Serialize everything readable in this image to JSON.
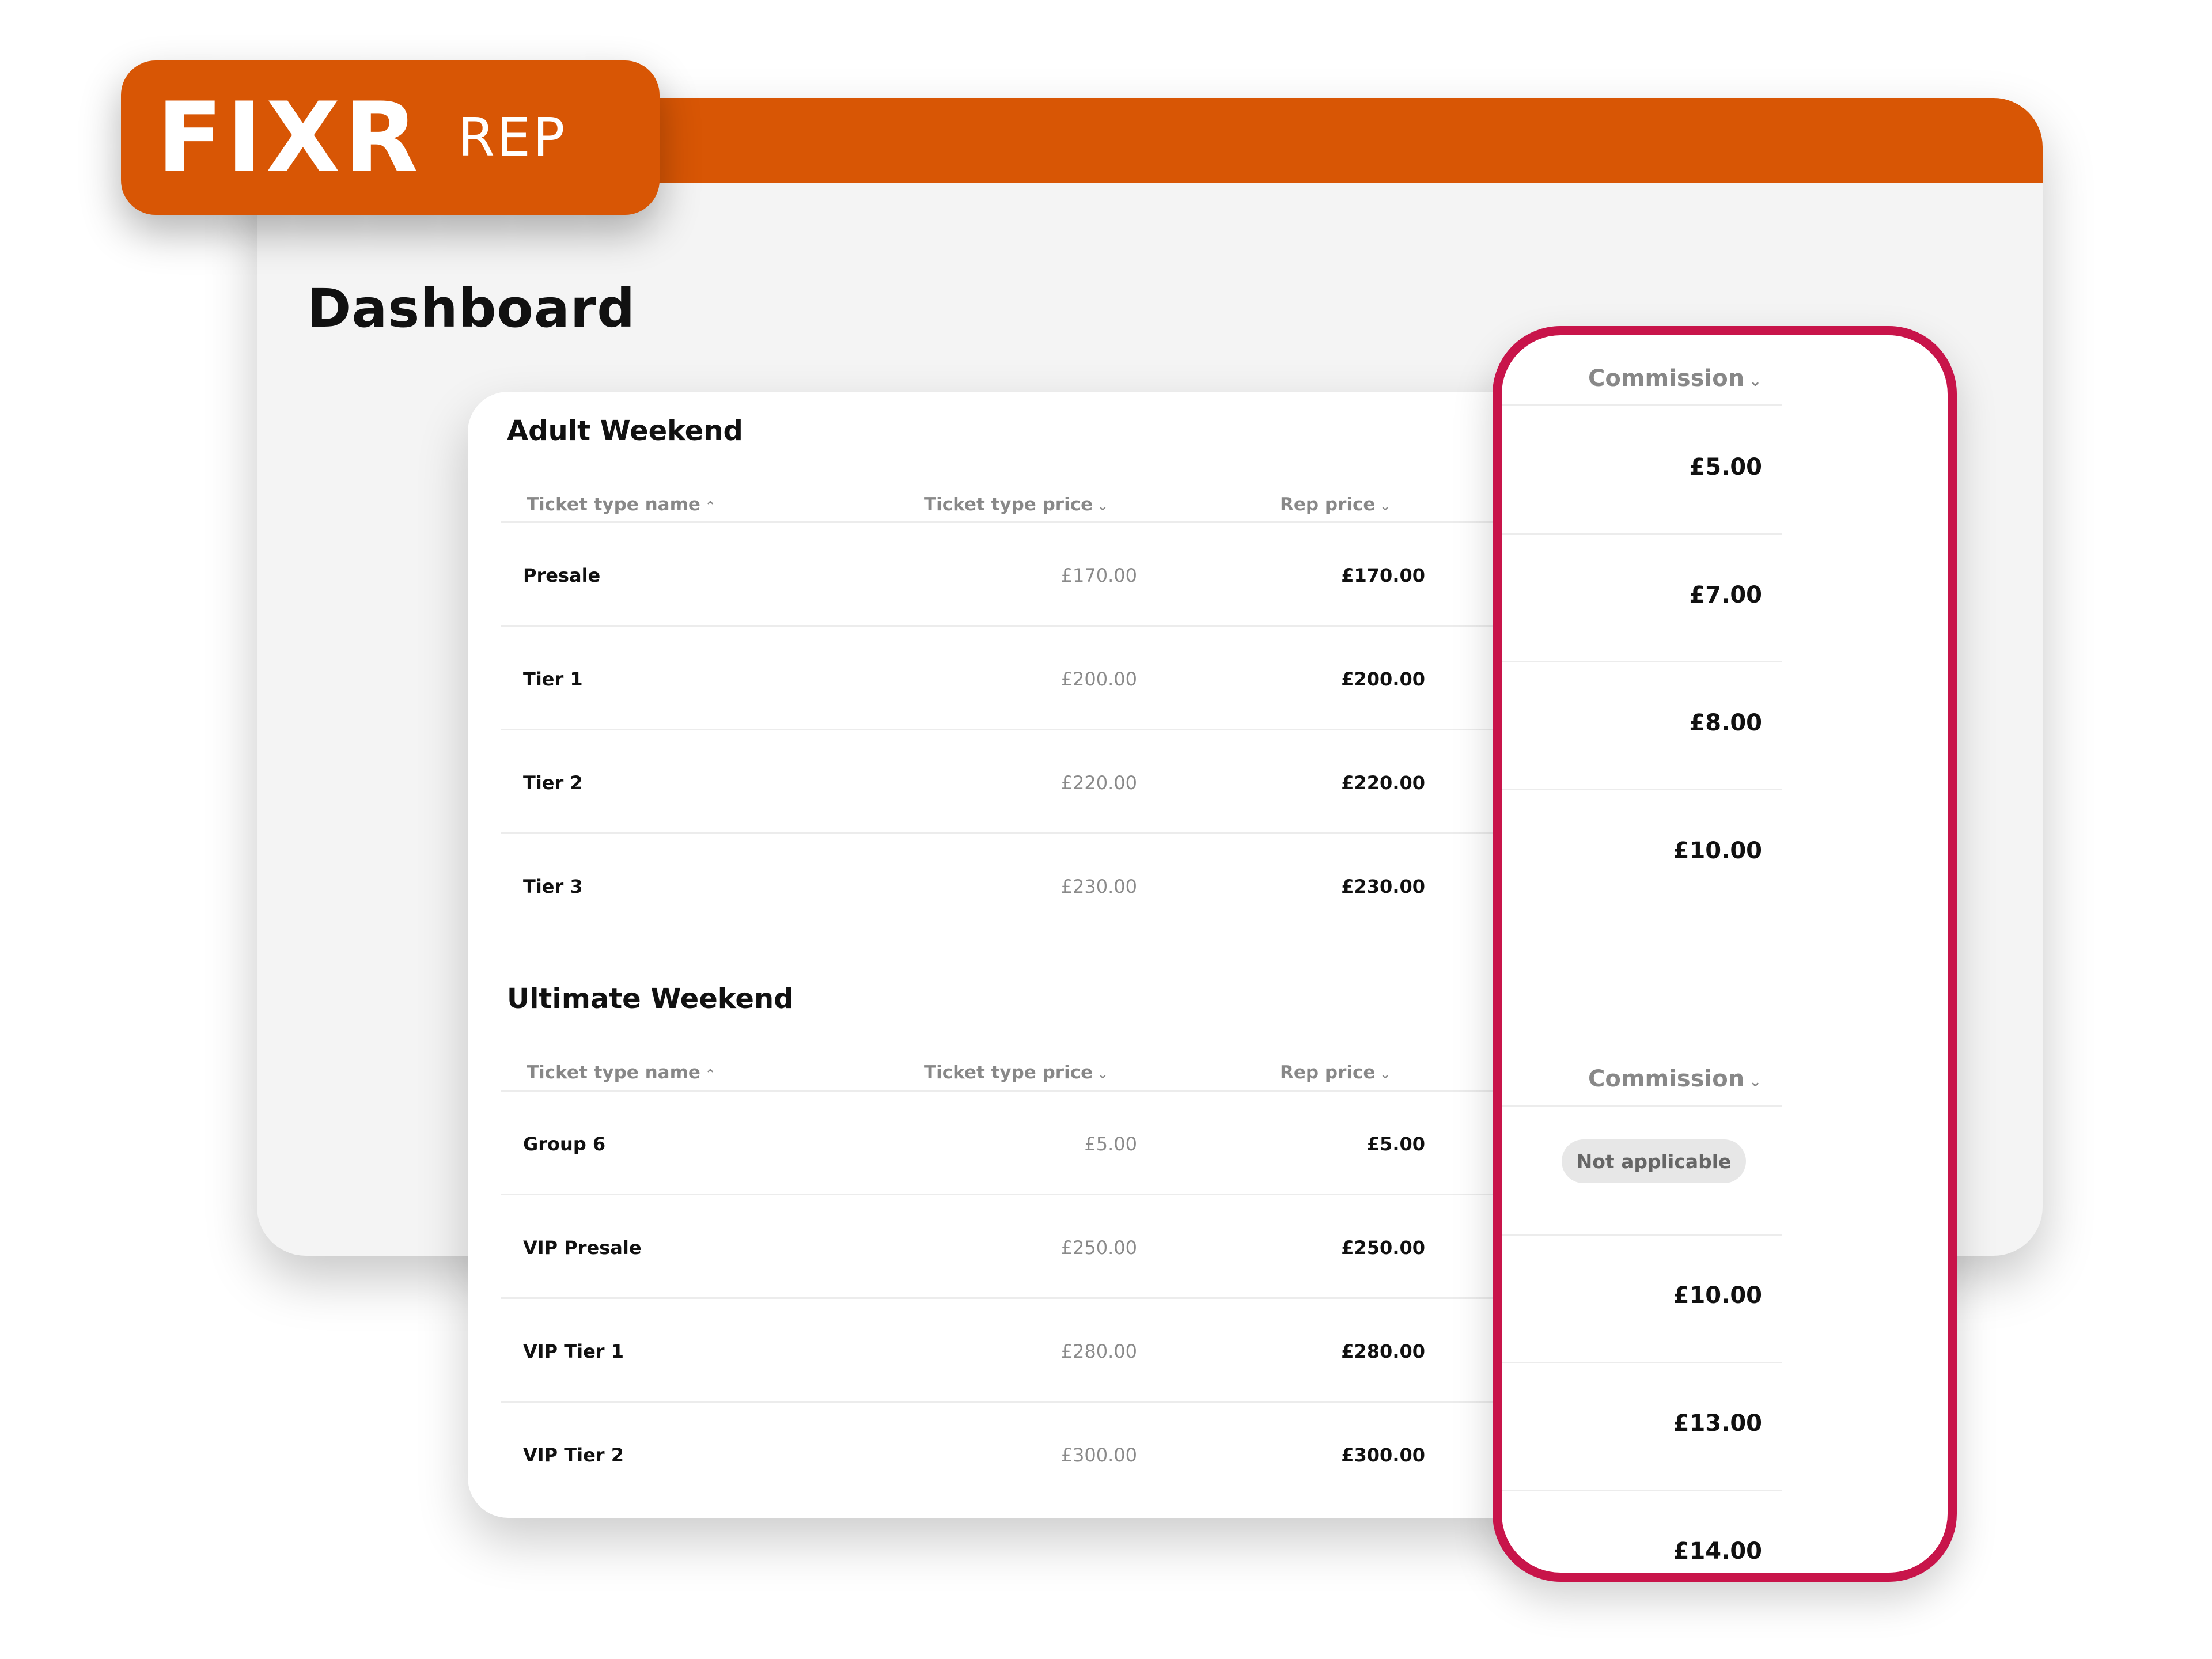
{
  "brand": {
    "logo": "FIXR",
    "sub": "REP",
    "color": "#d85605"
  },
  "page": {
    "title": "Dashboard"
  },
  "highlight_color": "#c8144a",
  "sections": [
    {
      "title": "Adult Weekend",
      "columns": {
        "name": "Ticket type name",
        "price": "Ticket type price",
        "rep": "Rep price",
        "commission": "Commission"
      },
      "rows": [
        {
          "name": "Presale",
          "price": "£170.00",
          "rep": "£170.00",
          "commission": "£5.00"
        },
        {
          "name": "Tier 1",
          "price": "£200.00",
          "rep": "£200.00",
          "commission": "£7.00"
        },
        {
          "name": "Tier 2",
          "price": "£220.00",
          "rep": "£220.00",
          "commission": "£8.00"
        },
        {
          "name": "Tier 3",
          "price": "£230.00",
          "rep": "£230.00",
          "commission": "£10.00"
        }
      ]
    },
    {
      "title": "Ultimate Weekend",
      "columns": {
        "name": "Ticket type name",
        "price": "Ticket type price",
        "rep": "Rep price",
        "commission": "Commission"
      },
      "rows": [
        {
          "name": "Group 6",
          "price": "£5.00",
          "rep": "£5.00",
          "commission": "Not applicable"
        },
        {
          "name": "VIP Presale",
          "price": "£250.00",
          "rep": "£250.00",
          "commission": "£10.00"
        },
        {
          "name": "VIP Tier 1",
          "price": "£280.00",
          "rep": "£280.00",
          "commission": "£13.00"
        },
        {
          "name": "VIP Tier 2",
          "price": "£300.00",
          "rep": "£300.00",
          "commission": "£14.00"
        }
      ]
    }
  ],
  "icons": {
    "sort_asc": "chevron-up-icon",
    "sort_desc": "chevron-down-icon"
  }
}
